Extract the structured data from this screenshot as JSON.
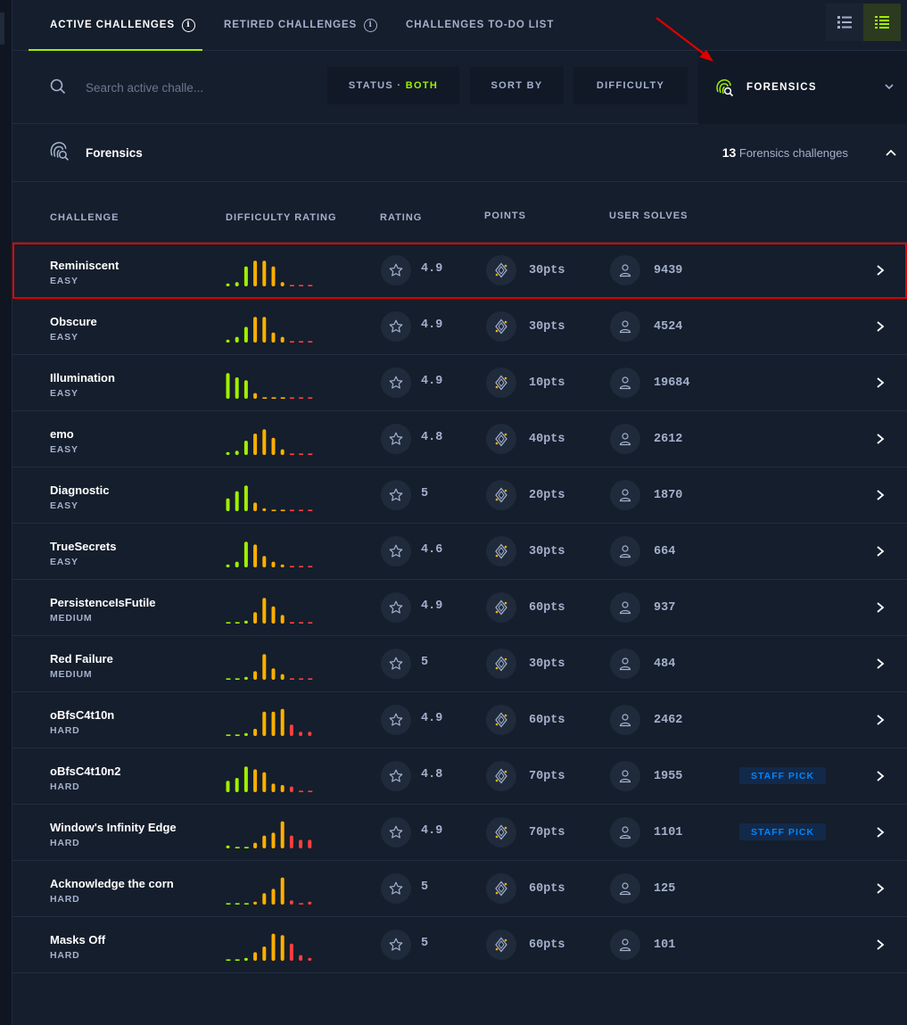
{
  "tabs": [
    {
      "label": "ACTIVE CHALLENGES"
    },
    {
      "label": "RETIRED CHALLENGES"
    },
    {
      "label": "CHALLENGES TO-DO LIST"
    }
  ],
  "search": {
    "placeholder": "Search active challe..."
  },
  "filters": {
    "status_label": "STATUS ·",
    "status_value": "BOTH",
    "sort_label": "SORT BY",
    "difficulty_label": "DIFFICULTY",
    "category_label": "FORENSICS"
  },
  "section": {
    "title": "Forensics",
    "count": "13",
    "count_suffix": " Forensics challenges"
  },
  "columns": {
    "challenge": "CHALLENGE",
    "difficulty_rating": "DIFFICULTY RATING",
    "rating": "RATING",
    "points": "POINTS",
    "user_solves": "USER SOLVES"
  },
  "colors": {
    "accent": "#9fef00",
    "bar_easy": "#9fef00",
    "bar_medium": "#ffaf00",
    "bar_hard": "#ff3e3e",
    "highlight": "#e00000",
    "staff_pick": "#0086ff"
  },
  "rows": [
    {
      "name": "Reminiscent",
      "difficulty": "EASY",
      "rating": "4.9",
      "points": "30pts",
      "solves": "9439",
      "staff_pick": "",
      "bars": [
        0.1,
        0.15,
        0.7,
        0.9,
        0.9,
        0.7,
        0.15,
        0.05,
        0.05,
        0.05
      ]
    },
    {
      "name": "Obscure",
      "difficulty": "EASY",
      "rating": "4.9",
      "points": "30pts",
      "solves": "4524",
      "staff_pick": "",
      "bars": [
        0.1,
        0.2,
        0.55,
        0.9,
        0.9,
        0.35,
        0.2,
        0.05,
        0.05,
        0.05
      ]
    },
    {
      "name": "Illumination",
      "difficulty": "EASY",
      "rating": "4.9",
      "points": "10pts",
      "solves": "19684",
      "staff_pick": "",
      "bars": [
        0.9,
        0.75,
        0.65,
        0.2,
        0.05,
        0.05,
        0.05,
        0.05,
        0.05,
        0.05
      ]
    },
    {
      "name": "emo",
      "difficulty": "EASY",
      "rating": "4.8",
      "points": "40pts",
      "solves": "2612",
      "staff_pick": "",
      "bars": [
        0.1,
        0.15,
        0.5,
        0.75,
        0.9,
        0.6,
        0.2,
        0.05,
        0.05,
        0.05
      ]
    },
    {
      "name": "Diagnostic",
      "difficulty": "EASY",
      "rating": "5",
      "points": "20pts",
      "solves": "1870",
      "staff_pick": "",
      "bars": [
        0.45,
        0.7,
        0.9,
        0.3,
        0.1,
        0.05,
        0.05,
        0.05,
        0.05,
        0.05
      ]
    },
    {
      "name": "TrueSecrets",
      "difficulty": "EASY",
      "rating": "4.6",
      "points": "30pts",
      "solves": "664",
      "staff_pick": "",
      "bars": [
        0.1,
        0.2,
        0.9,
        0.8,
        0.4,
        0.2,
        0.1,
        0.05,
        0.05,
        0.05
      ]
    },
    {
      "name": "PersistenceIsFutile",
      "difficulty": "MEDIUM",
      "rating": "4.9",
      "points": "60pts",
      "solves": "937",
      "staff_pick": "",
      "bars": [
        0.05,
        0.05,
        0.1,
        0.4,
        0.9,
        0.6,
        0.3,
        0.05,
        0.05,
        0.05
      ]
    },
    {
      "name": "Red Failure",
      "difficulty": "MEDIUM",
      "rating": "5",
      "points": "30pts",
      "solves": "484",
      "staff_pick": "",
      "bars": [
        0.05,
        0.05,
        0.1,
        0.3,
        0.9,
        0.4,
        0.2,
        0.05,
        0.05,
        0.05
      ]
    },
    {
      "name": "oBfsC4t10n",
      "difficulty": "HARD",
      "rating": "4.9",
      "points": "60pts",
      "solves": "2462",
      "staff_pick": "",
      "bars": [
        0.05,
        0.05,
        0.1,
        0.25,
        0.85,
        0.85,
        0.95,
        0.4,
        0.15,
        0.15
      ]
    },
    {
      "name": "oBfsC4t10n2",
      "difficulty": "HARD",
      "rating": "4.8",
      "points": "70pts",
      "solves": "1955",
      "staff_pick": "STAFF PICK",
      "bars": [
        0.4,
        0.5,
        0.9,
        0.8,
        0.7,
        0.3,
        0.25,
        0.2,
        0.05,
        0.05
      ]
    },
    {
      "name": "Window's Infinity Edge",
      "difficulty": "HARD",
      "rating": "4.9",
      "points": "70pts",
      "solves": "1101",
      "staff_pick": "STAFF PICK",
      "bars": [
        0.1,
        0.05,
        0.05,
        0.2,
        0.45,
        0.55,
        0.95,
        0.45,
        0.3,
        0.3
      ]
    },
    {
      "name": "Acknowledge the corn",
      "difficulty": "HARD",
      "rating": "5",
      "points": "60pts",
      "solves": "125",
      "staff_pick": "",
      "bars": [
        0.05,
        0.05,
        0.05,
        0.1,
        0.4,
        0.55,
        0.95,
        0.15,
        0.05,
        0.1
      ]
    },
    {
      "name": "Masks Off",
      "difficulty": "HARD",
      "rating": "5",
      "points": "60pts",
      "solves": "101",
      "staff_pick": "",
      "bars": [
        0.05,
        0.05,
        0.1,
        0.3,
        0.5,
        0.95,
        0.9,
        0.6,
        0.2,
        0.1
      ]
    }
  ]
}
